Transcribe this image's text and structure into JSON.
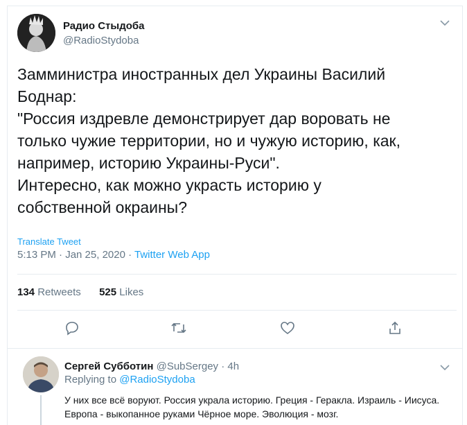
{
  "tweet": {
    "author_name": "Радио Стыдоба",
    "author_handle": "@RadioStydoba",
    "text": "Замминистра иностранных дел Украины Василий\nБоднар:\n\"Россия издревле демонстрирует дар воровать не\nтолько чужие территории, но и чужую историю, как,\nнапример, историю Украины-Руси\".\nИнтересно, как можно украсть историю у\nсобственной окраины?",
    "translate_label": "Translate Tweet",
    "time": "5:13 PM · Jan 25, 2020 · ",
    "source": "Twitter Web App",
    "retweets_count": "134",
    "retweets_label": "Retweets",
    "likes_count": "525",
    "likes_label": "Likes"
  },
  "actions": [
    "reply-icon",
    "retweet-icon",
    "like-icon",
    "share-icon"
  ],
  "reply": {
    "author_name": "Сергей Субботин",
    "author_handle": "@SubSergey · 4h",
    "replying_prefix": "Replying to ",
    "replying_to": "@RadioStydoba",
    "text": "У них все всё воруют. Россия украла историю. Греция - Геракла. Израиль - Иисуса. Европа - выкопанное руками Чёрное море. Эволюция - мозг."
  },
  "colors": {
    "accent": "#1da1f2",
    "secondary": "#657786",
    "border": "#e6ecf0"
  }
}
